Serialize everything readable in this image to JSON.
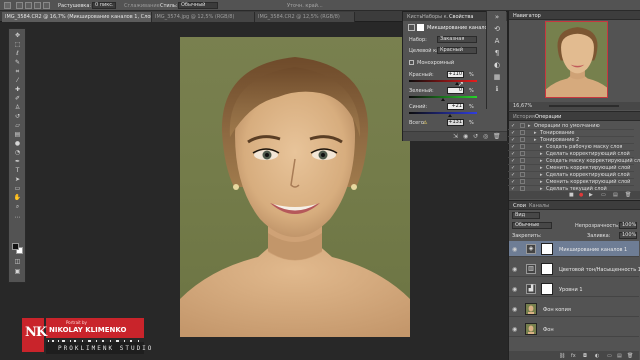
{
  "options_bar": {
    "label1": "Растушевка:",
    "value1": "0 пикс.",
    "label2": "Сглаживание",
    "label3": "Стиль:",
    "value3": "Обычный",
    "label4": "Уточн. край..."
  },
  "tabs": [
    {
      "label": "IMG_3584.CR2 @ 16,7% (Микширование каналов 1, Слой-маска/8)",
      "active": true
    },
    {
      "label": "IMG_3574.jpg @ 12,5% (RGB/8)",
      "active": false
    },
    {
      "label": "IMG_3584.CR2 @ 12,5% (RGB/8)",
      "active": false
    }
  ],
  "properties": {
    "tabs": [
      "Кисть",
      "Наборы к.",
      "Свойства"
    ],
    "title": "Микширование каналов",
    "preset_label": "Набор:",
    "preset_value": "Заказная",
    "output_label": "Целевой канал:",
    "output_value": "Красный",
    "mono_label": "Монохромный",
    "rows": [
      {
        "label": "Красный:",
        "value": "+110",
        "unit": "%"
      },
      {
        "label": "Зеленый:",
        "value": "0",
        "unit": "%"
      },
      {
        "label": "Синий:",
        "value": "+21",
        "unit": "%"
      },
      {
        "label": "Всего:",
        "value": "+131",
        "unit": "%"
      }
    ],
    "const_label": "Константа:",
    "const_value": "0",
    "const_unit": "%"
  },
  "navigator": {
    "title": "Навигатор",
    "zoom": "16,67%"
  },
  "actions": {
    "tabs": [
      "История",
      "Операции"
    ],
    "rows": [
      {
        "indent": 0,
        "text": "Операции по умолчанию"
      },
      {
        "indent": 1,
        "text": "Тонирование"
      },
      {
        "indent": 1,
        "text": "Тонирование 2"
      },
      {
        "indent": 2,
        "text": "Создать рабочую маску слоя"
      },
      {
        "indent": 2,
        "text": "Сделать корректирующий слой"
      },
      {
        "indent": 2,
        "text": "Создать маску корректирующий слой"
      },
      {
        "indent": 2,
        "text": "Сменить корректирующий слой"
      },
      {
        "indent": 2,
        "text": "Сделать корректирующий слой"
      },
      {
        "indent": 2,
        "text": "Сменить корректирующий слой"
      },
      {
        "indent": 2,
        "text": "Сделать текущий слой"
      }
    ]
  },
  "layers": {
    "tabs": [
      "Слои",
      "Каналы"
    ],
    "kind_label": "Вид",
    "blend_mode": "Обычные",
    "opacity_label": "Непрозрачность:",
    "opacity_value": "100%",
    "lock_label": "Закрепить:",
    "fill_label": "Заливка:",
    "fill_value": "100%",
    "items": [
      {
        "name": "Микширование каналов 1",
        "icon": "channel-mixer-icon",
        "selected": true
      },
      {
        "name": "Цветовой тон/Насыщенность 1",
        "icon": "hue-sat-icon",
        "selected": false
      },
      {
        "name": "Уровни 1",
        "icon": "levels-icon",
        "selected": false
      },
      {
        "name": "Фон копия",
        "icon": "photo-thumb",
        "selected": false
      },
      {
        "name": "Фон",
        "icon": "photo-thumb",
        "selected": false
      }
    ]
  },
  "logo": {
    "top": "Portrait by",
    "name": "NIKOLAY KLIMENKO",
    "monogram": "NK",
    "bottom": "PROKLIMENK STUDIO"
  }
}
